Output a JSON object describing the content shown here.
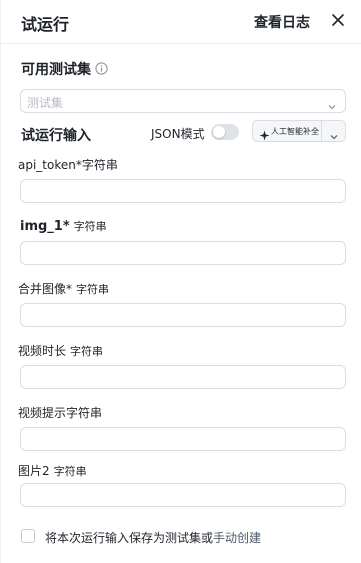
{
  "header": {
    "title": "试运行",
    "log_link": "查看日志"
  },
  "test_set": {
    "label": "可用测试集",
    "placeholder": "测试集"
  },
  "run_input": {
    "label": "试运行输入",
    "json_mode_label": "JSON模式",
    "json_mode_on": false,
    "ai_button_label": "人工智能补全"
  },
  "fields": [
    {
      "name": "api_token*",
      "type": "字符串",
      "value": ""
    },
    {
      "name": "img_1*",
      "type": "字符串",
      "value": ""
    },
    {
      "name": "合并图像*",
      "type": "字符串",
      "value": ""
    },
    {
      "name": "视频时长",
      "type": "字符串",
      "value": ""
    },
    {
      "name": "视频提示",
      "type": "字符串",
      "value": ""
    },
    {
      "name": "图片2",
      "type": "字符串",
      "value": ""
    }
  ],
  "footer": {
    "checkbox_checked": false,
    "text_prefix": "将本次运行输入保存为",
    "link_test_set": "测试集",
    "text_or": "或",
    "link_manual": "手动创建"
  }
}
